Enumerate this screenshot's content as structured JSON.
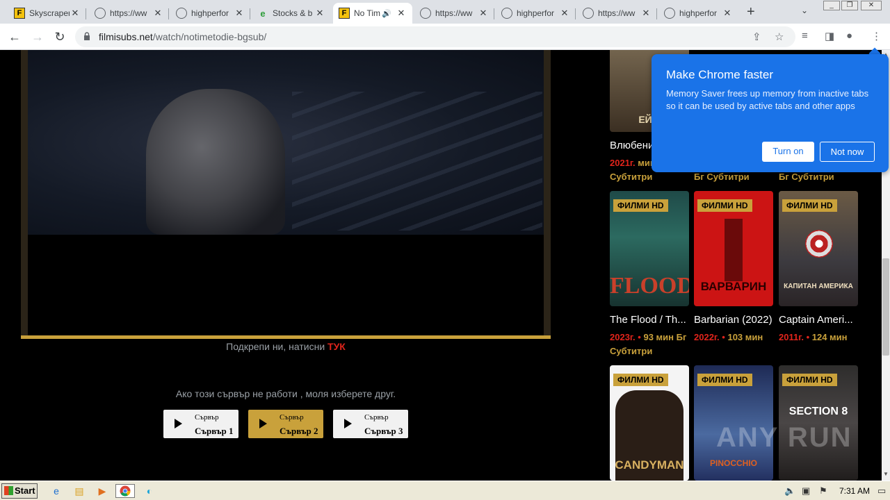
{
  "browser": {
    "tabs": [
      {
        "title": "Skyscraper",
        "favicon": "filmi-f-icon",
        "active": false
      },
      {
        "title": "https://ww",
        "favicon": "globe-icon",
        "active": false
      },
      {
        "title": "highperfor",
        "favicon": "globe-icon",
        "active": false
      },
      {
        "title": "Stocks & b",
        "favicon": "stocks-e-icon",
        "active": false
      },
      {
        "title": "No Tim",
        "favicon": "filmi-f-icon",
        "active": true,
        "audio": true
      },
      {
        "title": "https://ww",
        "favicon": "globe-icon",
        "active": false
      },
      {
        "title": "highperfor",
        "favicon": "globe-icon",
        "active": false
      },
      {
        "title": "https://ww",
        "favicon": "globe-icon",
        "active": false
      },
      {
        "title": "highperfor",
        "favicon": "globe-icon",
        "active": false
      }
    ],
    "url_host": "filmisubs.net",
    "url_path": "/watch/notimetodie-bgsub/"
  },
  "page": {
    "support_text": "Подкрепи ни, натисни",
    "support_link": "ТУК",
    "server_note": "Ако този сървър не работи , моля изберете друг.",
    "servers": [
      {
        "small": "Сървър",
        "big": "Сървър 1",
        "active": false
      },
      {
        "small": "Сървър",
        "big": "Сървър 2",
        "active": true
      },
      {
        "small": "Сървър",
        "big": "Сървър 3",
        "active": false
      }
    ]
  },
  "sidebar": {
    "badge": "ФИЛМИ HD",
    "row1": [
      {
        "title": "Влюбени",
        "year": "2021г.",
        "rest": "мин Бг Субтитри",
        "poster_text": "ЕЙФ"
      },
      {
        "title": "",
        "year": "",
        "rest": "Бг Субтитри",
        "poster_text": ""
      },
      {
        "title": "",
        "year": "",
        "rest": "Бг Субтитри",
        "poster_text": ""
      }
    ],
    "row2": [
      {
        "title": "The Flood / Th...",
        "year": "2023г.",
        "rest": "93 мин Бг Субтитри",
        "poster_text": "FLOOD"
      },
      {
        "title": "Barbarian (2022)",
        "year": "2022г.",
        "rest": "103 мин",
        "poster_text": "ВАРВАРИН"
      },
      {
        "title": "Captain Ameri...",
        "year": "2011г.",
        "rest": "124 мин",
        "poster_text": "КАПИТАН АМЕРИКА"
      }
    ],
    "row3": [
      {
        "poster_text": "CANDYMAN"
      },
      {
        "poster_text": "PINOCCHIO"
      },
      {
        "poster_text": "SECTION 8"
      }
    ]
  },
  "popup": {
    "title": "Make Chrome faster",
    "body": "Memory Saver frees up memory from inactive tabs so it can be used by active tabs and other apps",
    "turn_on": "Turn on",
    "not_now": "Not now"
  },
  "watermark": "ANY RUN",
  "taskbar": {
    "start": "Start",
    "clock": "7:31 AM"
  },
  "colors": {
    "accent_gold": "#c9a13b",
    "accent_red": "#e0241b",
    "chrome_blue": "#1a73e8"
  }
}
